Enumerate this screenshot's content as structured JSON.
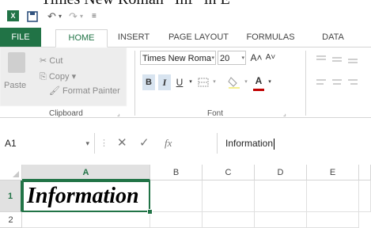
{
  "caption_fragment": "Times New Roman “Inf” in E",
  "quick_access": {
    "logo": "X",
    "undo_symbol": "↶",
    "redo_symbol": "↷",
    "customize_symbol": "≡"
  },
  "tabs": [
    "FILE",
    "HOME",
    "INSERT",
    "PAGE LAYOUT",
    "FORMULAS",
    "DATA"
  ],
  "active_tab": "HOME",
  "ribbon": {
    "clipboard": {
      "paste": "Paste",
      "cut": "Cut",
      "copy": "Copy",
      "format_painter": "Format Painter",
      "label": "Clipboard"
    },
    "font": {
      "name": "Times New Roma",
      "size": "20",
      "grow": "A˄",
      "shrink": "A˅",
      "bold": "B",
      "italic": "I",
      "underline": "U",
      "label": "Font"
    }
  },
  "formula_bar": {
    "name_box": "A1",
    "cancel_symbol": "✕",
    "enter_symbol": "✓",
    "fx_symbol": "fx",
    "content": "Information"
  },
  "grid": {
    "columns": [
      "A",
      "B",
      "C",
      "D",
      "E"
    ],
    "rows": [
      "1",
      "2"
    ],
    "cell_a1": "Information"
  },
  "colors": {
    "excel_green": "#217346",
    "font_color_red": "#c00000"
  }
}
